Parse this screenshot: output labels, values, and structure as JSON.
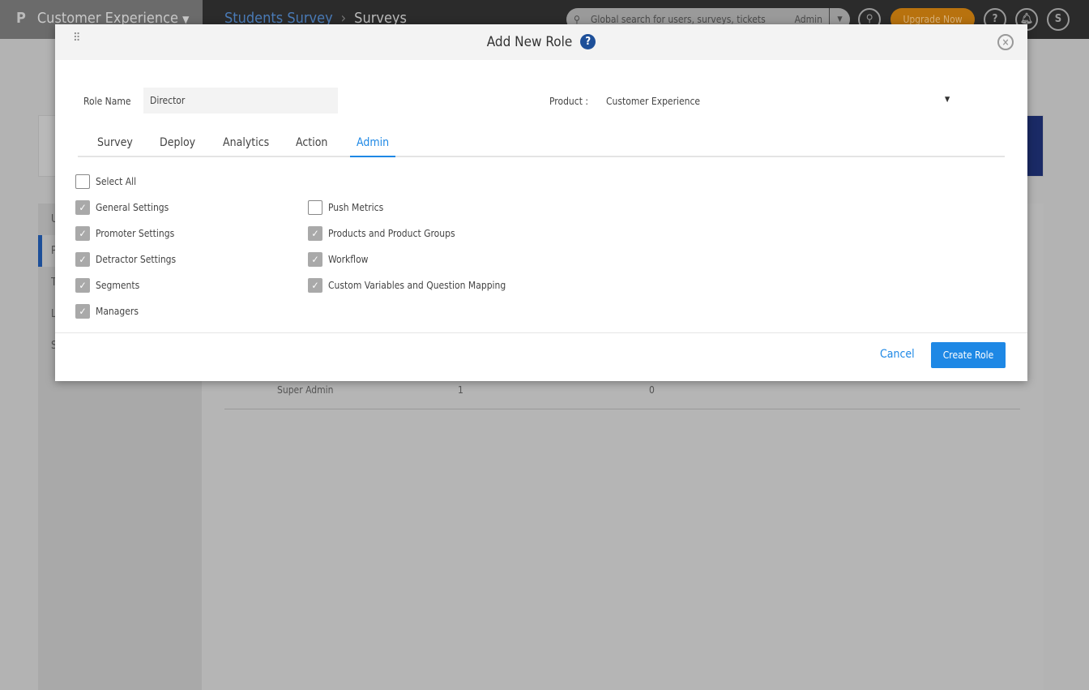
{
  "topbar": {
    "logo": "P",
    "product": "Customer Experience",
    "breadcrumb": [
      "Students Survey",
      "Surveys"
    ],
    "search_placeholder": "Global search for users, surveys, tickets",
    "search_scope": "Admin",
    "upgrade": "Upgrade Now",
    "help": "?",
    "avatar": "S"
  },
  "background": {
    "sidebar": [
      "U",
      "P",
      "T",
      "L",
      "S"
    ],
    "row": {
      "role": "Super Admin",
      "a": "1",
      "b": "0"
    }
  },
  "modal": {
    "title": "Add New Role",
    "help": "?",
    "role_name_label": "Role Name",
    "role_name_value": "Director",
    "product_label": "Product :",
    "product_value": "Customer Experience",
    "tabs": [
      "Survey",
      "Deploy",
      "Analytics",
      "Action",
      "Admin"
    ],
    "active_tab": "Admin",
    "select_all": {
      "label": "Select All",
      "checked": false
    },
    "col1": [
      {
        "label": "General Settings",
        "checked": true
      },
      {
        "label": "Promoter Settings",
        "checked": true
      },
      {
        "label": "Detractor Settings",
        "checked": true
      },
      {
        "label": "Segments",
        "checked": true
      },
      {
        "label": "Managers",
        "checked": true
      }
    ],
    "col2": [
      {
        "label": "Push Metrics",
        "checked": false
      },
      {
        "label": "Products and Product Groups",
        "checked": true
      },
      {
        "label": "Workflow",
        "checked": true
      },
      {
        "label": "Custom Variables and Question Mapping",
        "checked": true
      }
    ],
    "cancel": "Cancel",
    "create": "Create Role"
  },
  "colors": {
    "accent": "#1e88e5",
    "upgrade": "#b8720e",
    "brand_blue": "#1d4f99"
  }
}
